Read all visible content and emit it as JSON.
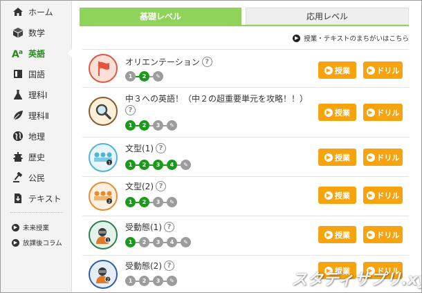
{
  "sidebar": {
    "items": [
      {
        "label": "ホーム",
        "icon": "home-icon"
      },
      {
        "label": "数学",
        "icon": "cube-icon"
      },
      {
        "label": "英語",
        "icon": "alphabet-icon",
        "active": true
      },
      {
        "label": "国語",
        "icon": "book-icon"
      },
      {
        "label": "理科Ⅰ",
        "icon": "flask-icon"
      },
      {
        "label": "理科Ⅱ",
        "icon": "leaf-icon"
      },
      {
        "label": "地理",
        "icon": "globe-icon"
      },
      {
        "label": "歴史",
        "icon": "castle-icon"
      },
      {
        "label": "公民",
        "icon": "gavel-icon"
      },
      {
        "label": "テキスト",
        "icon": "download-icon"
      }
    ],
    "sub_items": [
      {
        "label": "未来授業"
      },
      {
        "label": "放課後コラム"
      }
    ]
  },
  "tabs": {
    "basic": "基礎レベル",
    "applied": "応用レベル"
  },
  "errata_link": "授業・テキストのまちがいはこちら",
  "buttons": {
    "lesson": "授業",
    "drill": "ドリル"
  },
  "lessons": [
    {
      "title": "オリエンテーション",
      "steps": [
        "1",
        "2"
      ],
      "done": 2
    },
    {
      "title": "中３への英語！（中２の超重要単元を攻略！！）",
      "steps": [
        "1",
        "2",
        "3"
      ],
      "done": 2
    },
    {
      "title": "文型(1)",
      "steps": [
        "1",
        "2",
        "3",
        "4"
      ],
      "done": 3
    },
    {
      "title": "文型(2)",
      "steps": [
        "1",
        "2",
        "3"
      ],
      "done": 2
    },
    {
      "title": "受動態(1)",
      "steps": [
        "1",
        "2",
        "3",
        "4"
      ],
      "done": 1
    },
    {
      "title": "受動態(2)",
      "steps": [
        "1",
        "2",
        "3"
      ],
      "done": 0
    }
  ],
  "watermark": "スタディサプリ.xyz",
  "colors": {
    "accent_green": "#8fd35a",
    "step_green": "#1a9a1a",
    "button_orange": "#f5a410",
    "active_text": "#2a8a1e"
  }
}
